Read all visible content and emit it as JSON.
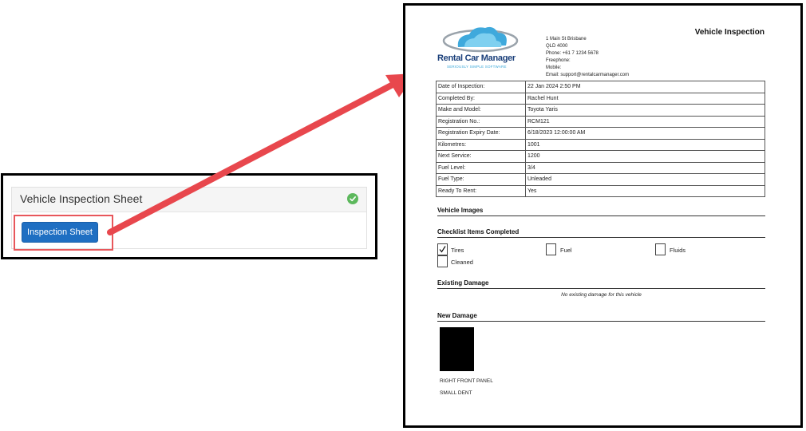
{
  "card": {
    "title": "Vehicle Inspection Sheet",
    "button_label": "Inspection Sheet",
    "status_icon": "check-circle-icon",
    "status_color": "#5cb85c",
    "button_color": "#1f6fc2",
    "highlight_color": "#e8575b"
  },
  "arrow": {
    "color": "#e8474d"
  },
  "document": {
    "logo": {
      "name": "Rental Car Manager",
      "tagline": "SERIOUSLY SIMPLE SOFTWARE"
    },
    "address_lines": [
      "1 Main St Brisbane",
      "QLD 4000",
      "Phone: +61 7 1234 5678",
      "Freephone:",
      "Mobile:",
      "Email: support@rentalcarmanager.com"
    ],
    "title": "Vehicle Inspection",
    "details": [
      {
        "label": "Date of Inspection:",
        "value": "22 Jan 2024 2:50 PM"
      },
      {
        "label": "Completed By:",
        "value": "Rachel Hunt"
      },
      {
        "label": "Make and Model:",
        "value": "Toyota Yaris"
      },
      {
        "label": "Registration No.:",
        "value": "RCM121"
      },
      {
        "label": "Registration Expiry Date:",
        "value": "6/18/2023 12:00:00 AM"
      },
      {
        "label": "Kilometres:",
        "value": "1001"
      },
      {
        "label": "Next Service:",
        "value": "1200"
      },
      {
        "label": "Fuel Level:",
        "value": "3/4"
      },
      {
        "label": "Fuel Type:",
        "value": "Unleaded"
      },
      {
        "label": "Ready To Rent:",
        "value": "Yes"
      }
    ],
    "sections": {
      "images": "Vehicle Images",
      "checklist": "Checklist Items Completed",
      "existing": "Existing Damage",
      "new": "New Damage"
    },
    "checklist": [
      {
        "label": "Tires",
        "checked": true
      },
      {
        "label": "Fuel",
        "checked": false
      },
      {
        "label": "Fluids",
        "checked": false
      },
      {
        "label": "Cleaned",
        "checked": false
      }
    ],
    "no_existing_damage": "No existing damage for this vehicle",
    "new_damage": {
      "location": "RIGHT FRONT PANEL",
      "description": "SMALL DENT"
    }
  }
}
